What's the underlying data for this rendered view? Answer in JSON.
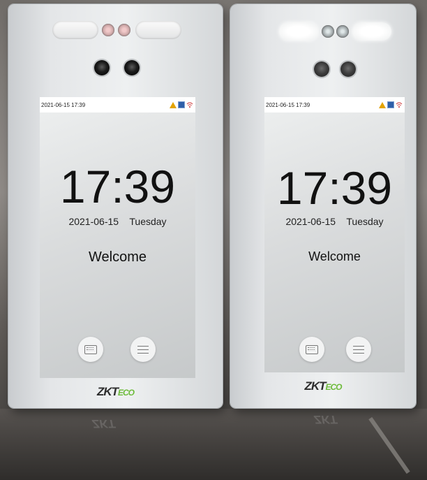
{
  "devices": [
    {
      "status_time": "2021-06-15 17:39",
      "clock": "17:39",
      "date": "2021-06-15",
      "weekday": "Tuesday",
      "welcome": "Welcome",
      "logo_main": "ZKT",
      "logo_suffix": "ECO"
    },
    {
      "status_time": "2021-06-15 17:39",
      "clock": "17:39",
      "date": "2021-06-15",
      "weekday": "Tuesday",
      "welcome": "Welcome",
      "logo_main": "ZKT",
      "logo_suffix": "ECO"
    }
  ],
  "icons": [
    "warning-icon",
    "network-icon",
    "wifi-icon",
    "keyboard-icon",
    "menu-icon"
  ],
  "colors": {
    "logo_green": "#6dbb3a",
    "logo_dark": "#2d2d2d",
    "warning": "#e3a300"
  }
}
